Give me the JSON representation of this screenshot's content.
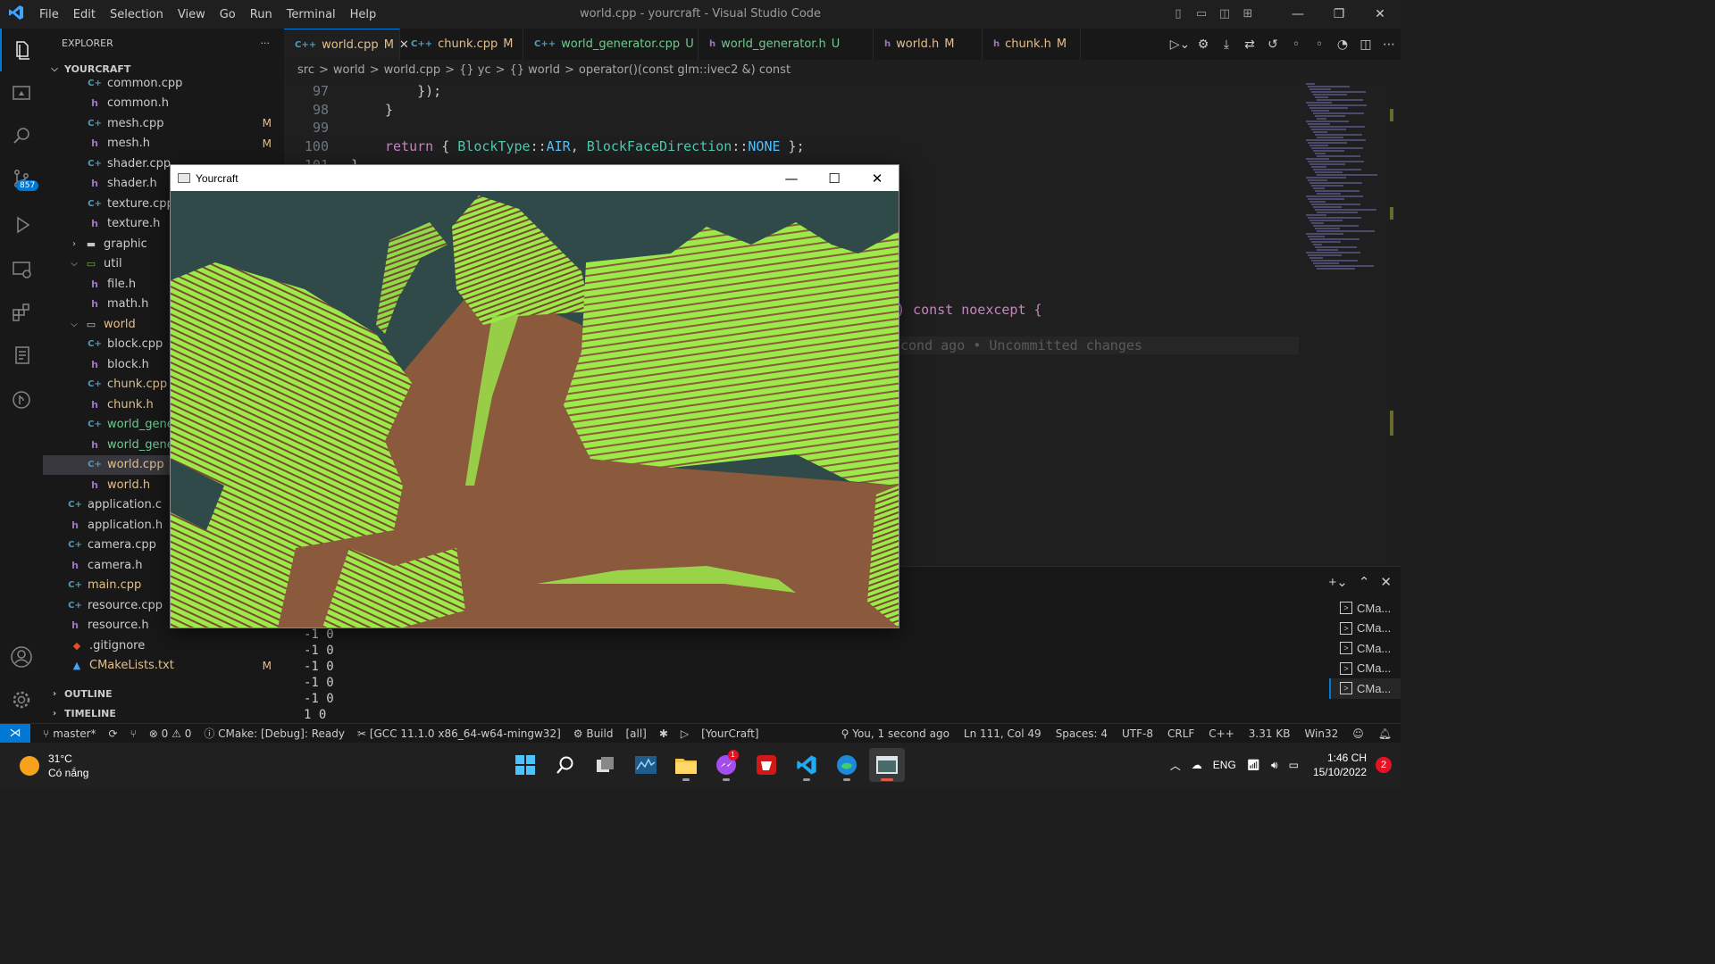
{
  "titlebar": {
    "menu": [
      "File",
      "Edit",
      "Selection",
      "View",
      "Go",
      "Run",
      "Terminal",
      "Help"
    ],
    "title": "world.cpp - yourcraft - Visual Studio Code"
  },
  "activity": {
    "source_control_badge": "857"
  },
  "sidebar": {
    "header": "EXPLORER",
    "more": "···",
    "root": "YOURCRAFT",
    "items": [
      {
        "label": "common.cpp",
        "icon": "cpp",
        "indent": 2
      },
      {
        "label": "common.h",
        "icon": "h",
        "indent": 2
      },
      {
        "label": "mesh.cpp",
        "icon": "cpp",
        "indent": 2,
        "status": "M"
      },
      {
        "label": "mesh.h",
        "icon": "h",
        "indent": 2,
        "status": "M"
      },
      {
        "label": "shader.cpp",
        "icon": "cpp",
        "indent": 2
      },
      {
        "label": "shader.h",
        "icon": "h",
        "indent": 2
      },
      {
        "label": "texture.cpp",
        "icon": "cpp",
        "indent": 2
      },
      {
        "label": "texture.h",
        "icon": "h",
        "indent": 2
      },
      {
        "label": "graphic",
        "icon": "folder",
        "indent": 1,
        "collapsed": true
      },
      {
        "label": "util",
        "icon": "folder-open",
        "indent": 1
      },
      {
        "label": "file.h",
        "icon": "h",
        "indent": 2
      },
      {
        "label": "math.h",
        "icon": "h",
        "indent": 2
      },
      {
        "label": "world",
        "icon": "folder-open",
        "indent": 1,
        "status_color": "mod"
      },
      {
        "label": "block.cpp",
        "icon": "cpp",
        "indent": 2
      },
      {
        "label": "block.h",
        "icon": "h",
        "indent": 2
      },
      {
        "label": "chunk.cpp",
        "icon": "cpp",
        "indent": 2,
        "status_color": "mod"
      },
      {
        "label": "chunk.h",
        "icon": "h",
        "indent": 2,
        "status_color": "mod"
      },
      {
        "label": "world_gene",
        "icon": "cpp",
        "indent": 2,
        "status_color": "untracked"
      },
      {
        "label": "world_gene",
        "icon": "h",
        "indent": 2,
        "status_color": "untracked"
      },
      {
        "label": "world.cpp",
        "icon": "cpp",
        "indent": 2,
        "status_color": "mod",
        "selected": true
      },
      {
        "label": "world.h",
        "icon": "h",
        "indent": 2,
        "status_color": "mod"
      },
      {
        "label": "application.c",
        "icon": "cpp",
        "indent": 1
      },
      {
        "label": "application.h",
        "icon": "h",
        "indent": 1
      },
      {
        "label": "camera.cpp",
        "icon": "cpp",
        "indent": 1
      },
      {
        "label": "camera.h",
        "icon": "h",
        "indent": 1
      },
      {
        "label": "main.cpp",
        "icon": "cpp",
        "indent": 1,
        "status_color": "mod"
      },
      {
        "label": "resource.cpp",
        "icon": "cpp",
        "indent": 1
      },
      {
        "label": "resource.h",
        "icon": "h",
        "indent": 1
      },
      {
        "label": ".gitignore",
        "icon": "git",
        "indent": 0
      },
      {
        "label": "CMakeLists.txt",
        "icon": "cmake",
        "indent": 0,
        "status": "M",
        "status_color": "mod"
      }
    ],
    "outline": "OUTLINE",
    "timeline": "TIMELINE"
  },
  "tabs": [
    {
      "label": "world.cpp",
      "icon": "C++",
      "status": "M",
      "active": true,
      "color": "mod"
    },
    {
      "label": "chunk.cpp",
      "icon": "C++",
      "status": "M",
      "color": "mod"
    },
    {
      "label": "world_generator.cpp",
      "icon": "C++",
      "status": "U",
      "color": "untracked"
    },
    {
      "label": "world_generator.h",
      "icon": "h",
      "status": "U",
      "color": "untracked"
    },
    {
      "label": "world.h",
      "icon": "h",
      "status": "M",
      "color": "mod"
    },
    {
      "label": "chunk.h",
      "icon": "h",
      "status": "M",
      "color": "mod"
    }
  ],
  "breadcrumb": [
    "src",
    ">",
    "world",
    ">",
    "world.cpp",
    ">",
    "{} yc",
    ">",
    "{} world",
    ">",
    "operator()(const glm::ivec2 &) const"
  ],
  "editor": {
    "lines": [
      {
        "num": "97",
        "code": "    });"
      },
      {
        "num": "98",
        "code": "}"
      },
      {
        "num": "99",
        "code": ""
      },
      {
        "num": "100",
        "code_kw": "return",
        "code_rest_1": " { ",
        "code_ty1": "BlockType",
        "code_rest_2": "::",
        "code_en1": "AIR",
        "code_rest_3": ", ",
        "code_ty2": "BlockFaceDirection",
        "code_rest_4": "::",
        "code_en2": "NONE",
        "code_rest_5": " };"
      },
      {
        "num": "101",
        "code": "}"
      }
    ],
    "visible_fragment": ") const noexcept {",
    "blame": "cond ago • Uncommitted changes"
  },
  "terminal": {
    "lines": [
      "-1 0",
      "-1 0",
      "-1 0",
      "-1 0",
      "-1 0",
      "1 0"
    ],
    "tabs": [
      "CMa...",
      "CMa...",
      "CMa...",
      "CMa...",
      "CMa..."
    ]
  },
  "statusbar": {
    "branch": "master*",
    "problems": "⊗ 0 ⚠ 0",
    "cmake": "CMake: [Debug]: Ready",
    "kit": "[GCC 11.1.0 x86_64-w64-mingw32]",
    "build": "Build",
    "target": "[all]",
    "launch": "[YourCraft]",
    "blame": "You, 1 second ago",
    "position": "Ln 111, Col 49",
    "spaces": "Spaces: 4",
    "encoding": "UTF-8",
    "eol": "CRLF",
    "language": "C++",
    "size": "3.31 KB",
    "platform": "Win32"
  },
  "taskbar": {
    "temperature": "31°C",
    "weather": "Có nắng",
    "language": "ENG",
    "time": "1:46 CH",
    "date": "15/10/2022",
    "notifications": "2",
    "messenger_badge": "1"
  },
  "game_window": {
    "title": "Yourcraft",
    "sky_color": "#2f4a48",
    "grass_color": "#9bea4a",
    "dirt_color": "#8b5a3c"
  }
}
